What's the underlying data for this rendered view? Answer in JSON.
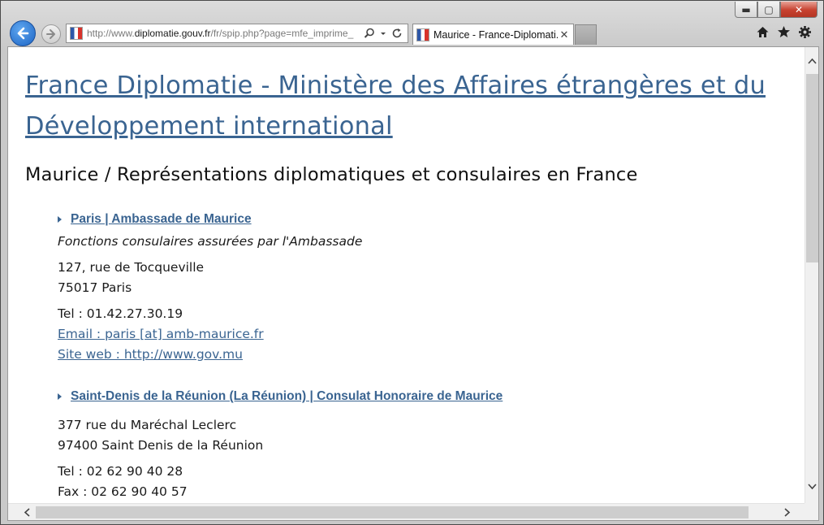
{
  "browser": {
    "address_url_prefix": "http://www.",
    "address_url_domain": "diplomatie.gouv.fr",
    "address_url_path": "/fr/spip.php?page=mfe_imprime_",
    "tab_title": "Maurice - France-Diplomati...",
    "tab_close": "✕",
    "window_min": "▬",
    "window_max": "▢",
    "window_close": "✕",
    "icons": {
      "back": "arrow-left-icon",
      "forward": "arrow-right-icon",
      "search": "search-icon",
      "refresh": "refresh-icon",
      "home": "home-icon",
      "favorites": "star-icon",
      "settings": "gear-icon"
    }
  },
  "page": {
    "site_title": "France Diplomatie - Ministère des Affaires étrangères et du Développement international",
    "heading": "Maurice / Représentations diplomatiques et consulaires en France",
    "entries": [
      {
        "title": "Paris | Ambassade de Maurice",
        "note": "Fonctions consulaires assurées par l'Ambassade",
        "address1": "127, rue de Tocqueville",
        "address2": "75017  Paris",
        "tel": "Tel : 01.42.27.30.19",
        "email": "Email : paris [at] amb-maurice.fr",
        "website": "Site web : http://www.gov.mu"
      },
      {
        "title": "Saint-Denis de la Réunion (La Réunion) | Consulat Honoraire de Maurice",
        "address1": "377 rue du Maréchal Leclerc",
        "address2": "97400  Saint Denis de la Réunion",
        "tel": "Tel : 02 62 90 40 28",
        "fax": "Fax : 02 62 90 40 57"
      }
    ]
  },
  "colors": {
    "link": "#3a6491",
    "text": "#1a1a1a",
    "close_button": "#c7412f"
  }
}
